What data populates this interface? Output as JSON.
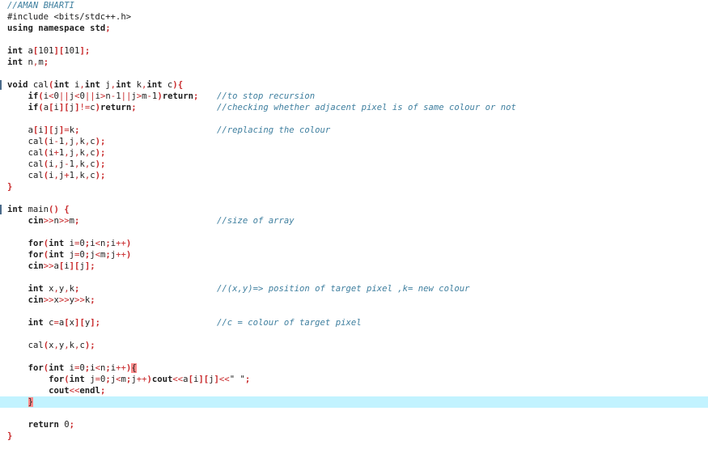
{
  "editor": {
    "lines": [
      {
        "t": 0,
        "code": "//AMAN BHARTI"
      },
      {
        "t": 14,
        "code": "#include <bits/stdc++.h>"
      },
      {
        "t": 28,
        "code": "using namespace std;"
      },
      {
        "t": 56,
        "code": "int a[101][101];"
      },
      {
        "t": 70,
        "code": "int n,m;"
      },
      {
        "t": 98,
        "code": "void cal(int i,int j,int k,int c){",
        "marker": true
      },
      {
        "t": 112,
        "code": "    if(i<0||j<0||i>n-1||j>m-1)return;",
        "comment": "//to stop recursion"
      },
      {
        "t": 126,
        "code": "    if(a[i][j]!=c)return;",
        "comment": "//checking whether adjacent pixel is of same colour or not"
      },
      {
        "t": 154,
        "code": "    a[i][j]=k;",
        "comment": "//replacing the colour"
      },
      {
        "t": 168,
        "code": "    cal(i-1,j,k,c);"
      },
      {
        "t": 182,
        "code": "    cal(i+1,j,k,c);"
      },
      {
        "t": 196,
        "code": "    cal(i,j-1,k,c);"
      },
      {
        "t": 210,
        "code": "    cal(i,j+1,k,c);"
      },
      {
        "t": 224,
        "code": "}"
      },
      {
        "t": 252,
        "code": "int main() {",
        "marker": true
      },
      {
        "t": 266,
        "code": "    cin>>n>>m;",
        "comment": "//size of array"
      },
      {
        "t": 294,
        "code": "    for(int i=0;i<n;i++)"
      },
      {
        "t": 308,
        "code": "    for(int j=0;j<m;j++)"
      },
      {
        "t": 322,
        "code": "    cin>>a[i][j];"
      },
      {
        "t": 350,
        "code": "    int x,y,k;",
        "comment": "//(x,y)=> position of target pixel ,k= new colour"
      },
      {
        "t": 364,
        "code": "    cin>>x>>y>>k;"
      },
      {
        "t": 392,
        "code": "    int c=a[x][y];",
        "comment": "//c = colour of target pixel"
      },
      {
        "t": 420,
        "code": "    cal(x,y,k,c);"
      },
      {
        "t": 448,
        "code": "    for(int i=0;i<n;i++){"
      },
      {
        "t": 462,
        "code": "        for(int j=0;j<m;j++)cout<<a[i][j]<<\" \";"
      },
      {
        "t": 476,
        "code": "        cout<<endl;"
      },
      {
        "t": 490,
        "code": "    }",
        "current": true
      },
      {
        "t": 518,
        "code": "    return 0;"
      },
      {
        "t": 532,
        "code": "}"
      }
    ]
  },
  "colors": {
    "comment": "#3f7f9f",
    "keyword": "#1e1e1e",
    "punctuation": "#c8282a",
    "current_line": "#c2f3ff",
    "bracket_match": "#ff8a8a"
  }
}
